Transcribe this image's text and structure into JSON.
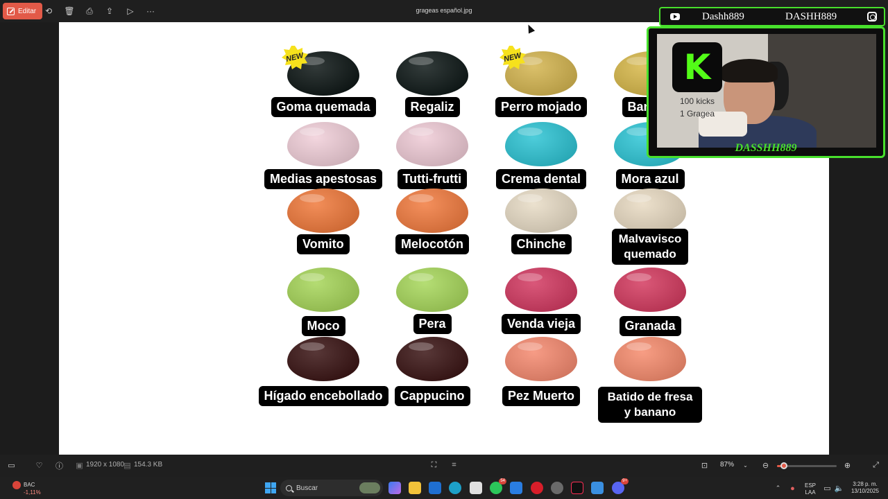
{
  "titlebar": {
    "edit_label": "Editar",
    "file_name": "grageas español.jpg",
    "icons": [
      "rotate-icon",
      "delete-icon",
      "print-icon",
      "share-icon",
      "slideshow-icon",
      "more-icon",
      "close-icon"
    ]
  },
  "jellybeans": [
    {
      "label": "Goma quemada",
      "color": "#0e1716",
      "new_badge": "NEW"
    },
    {
      "label": "Regaliz",
      "color": "#0f1918"
    },
    {
      "label": "Perro mojado",
      "color": "#d4b550",
      "new_badge": "NEW"
    },
    {
      "label": "Banana",
      "color": "#d7b84a"
    },
    {
      "label": "Medias apestosas",
      "color": "#f1cfd9"
    },
    {
      "label": "Tutti-frutti",
      "color": "#efcbd6"
    },
    {
      "label": "Crema dental",
      "color": "#2ec4d4"
    },
    {
      "label": "Mora azul",
      "color": "#2fc6d6"
    },
    {
      "label": "Vomito",
      "color": "#f07a3c"
    },
    {
      "label": "Melocotón",
      "color": "#f27c40"
    },
    {
      "label": "Chinche",
      "color": "#e8dcc6"
    },
    {
      "label": "Malvavisco quemado",
      "color": "#e9dbc3"
    },
    {
      "label": "Moco",
      "color": "#a7d65a"
    },
    {
      "label": "Pera",
      "color": "#a8d85c"
    },
    {
      "label": "Venda vieja",
      "color": "#d33a62"
    },
    {
      "label": "Granada",
      "color": "#d43b60"
    },
    {
      "label": "Hígado encebollado",
      "color": "#3a1414"
    },
    {
      "label": "Cappucino",
      "color": "#3b1515"
    },
    {
      "label": "Pez Muerto",
      "color": "#f58a70"
    },
    {
      "label": "Batido de fresa y banano",
      "color": "#f68c6e"
    }
  ],
  "overlay": {
    "youtube_name": "Dashh889",
    "instagram_name": "DASHH889",
    "kick_line1": "100 kicks",
    "kick_line2": "1 Gragea",
    "caption": "DASSHH889",
    "accent": "#48e02c"
  },
  "viewer_bar": {
    "dimensions": "1920 x 1080",
    "file_size": "154.3 KB",
    "zoom": "87%",
    "zoom_fraction": 0.12
  },
  "taskbar": {
    "ticker": "BAC",
    "ticker_change": "-1,11%",
    "search_placeholder": "Buscar",
    "badge_whatsapp": "54",
    "badge_discord": "9+",
    "lang_line1": "ESP",
    "lang_line2": "LAA",
    "time": "3:28 p. m.",
    "date": "13/10/2025"
  }
}
